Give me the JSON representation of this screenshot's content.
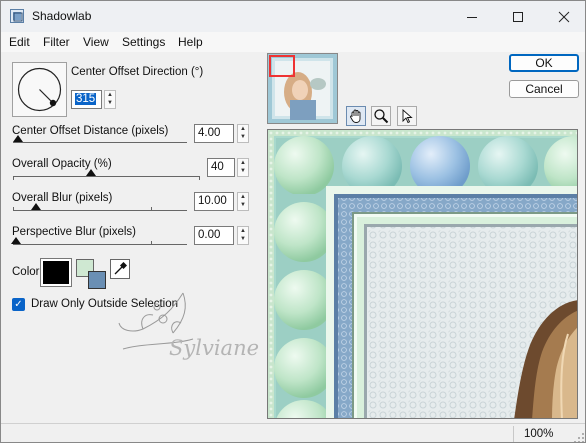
{
  "window": {
    "title": "Shadowlab",
    "minimize_icon": "minimize-icon",
    "maximize_icon": "maximize-icon",
    "close_icon": "close-icon"
  },
  "menu": [
    "Edit",
    "Filter",
    "View",
    "Settings",
    "Help"
  ],
  "controls": {
    "direction": {
      "label": "Center Offset Direction (°)",
      "value": "315"
    },
    "distance": {
      "label": "Center Offset Distance (pixels)",
      "value": "4.00"
    },
    "opacity": {
      "label": "Overall Opacity (%)",
      "value": "40"
    },
    "blur": {
      "label": "Overall Blur (pixels)",
      "value": "10.00"
    },
    "perspective_blur": {
      "label": "Perspective Blur (pixels)",
      "value": "0.00"
    },
    "color_label": "Color",
    "draw_outside": {
      "label": "Draw Only Outside Selection",
      "checked": true
    }
  },
  "colors": {
    "shadow_color": "#000000",
    "foreground_swatch": "#cfe8d2",
    "background_swatch": "#6a8fb4",
    "accent": "#0a64c8"
  },
  "buttons": {
    "ok": "OK",
    "cancel": "Cancel"
  },
  "tools": [
    "hand-pan-icon",
    "zoom-icon",
    "pointer-arrow-icon"
  ],
  "watermark_text": "Sylviane",
  "status": {
    "zoom": "100%"
  }
}
